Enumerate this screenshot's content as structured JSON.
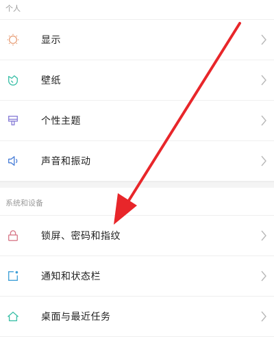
{
  "sections": [
    {
      "header": "个人",
      "items": [
        {
          "label": "显示",
          "icon": "display-icon"
        },
        {
          "label": "壁纸",
          "icon": "wallpaper-icon"
        },
        {
          "label": "个性主题",
          "icon": "theme-icon"
        },
        {
          "label": "声音和振动",
          "icon": "sound-icon"
        }
      ]
    },
    {
      "header": "系统和设备",
      "items": [
        {
          "label": "锁屏、密码和指纹",
          "icon": "lock-icon"
        },
        {
          "label": "通知和状态栏",
          "icon": "notification-icon"
        },
        {
          "label": "桌面与最近任务",
          "icon": "home-icon"
        }
      ]
    }
  ],
  "colors": {
    "accent": "#e8a07a",
    "arrow": "#e8262a",
    "icon_display": "#e8a07a",
    "icon_wallpaper": "#3cc0a8",
    "icon_theme": "#8a7fd8",
    "icon_sound": "#4a7fd8",
    "icon_lock": "#d87a8a",
    "icon_notification": "#3fa0d8",
    "icon_home": "#3cc0a8"
  }
}
